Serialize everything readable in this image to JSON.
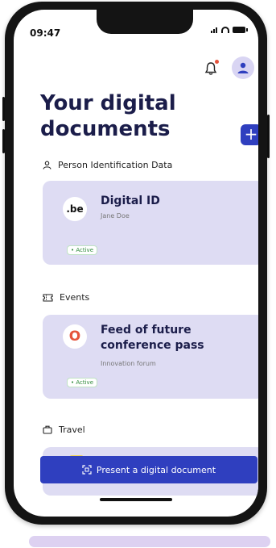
{
  "status": {
    "time": "09:47"
  },
  "header": {
    "title": "Your digital documents",
    "add_label": "+"
  },
  "sections": {
    "pid": {
      "label": "Person Identification Data"
    },
    "events": {
      "label": "Events"
    },
    "travel": {
      "label": "Travel"
    }
  },
  "cards": {
    "digital_id": {
      "logo_text": ".be",
      "title": "Digital ID",
      "subtitle": "Jane Doe",
      "status": "• Active"
    },
    "conference": {
      "logo_text": "O",
      "title": "Feed of future conference pass",
      "subtitle": "Innovation forum",
      "status": "• Active"
    }
  },
  "present_button": {
    "label": "Present a digital document"
  },
  "colors": {
    "primary": "#2f3fbf",
    "card_bg": "#dedcf3",
    "title": "#1b1d4a",
    "active": "#2f8a3b"
  }
}
